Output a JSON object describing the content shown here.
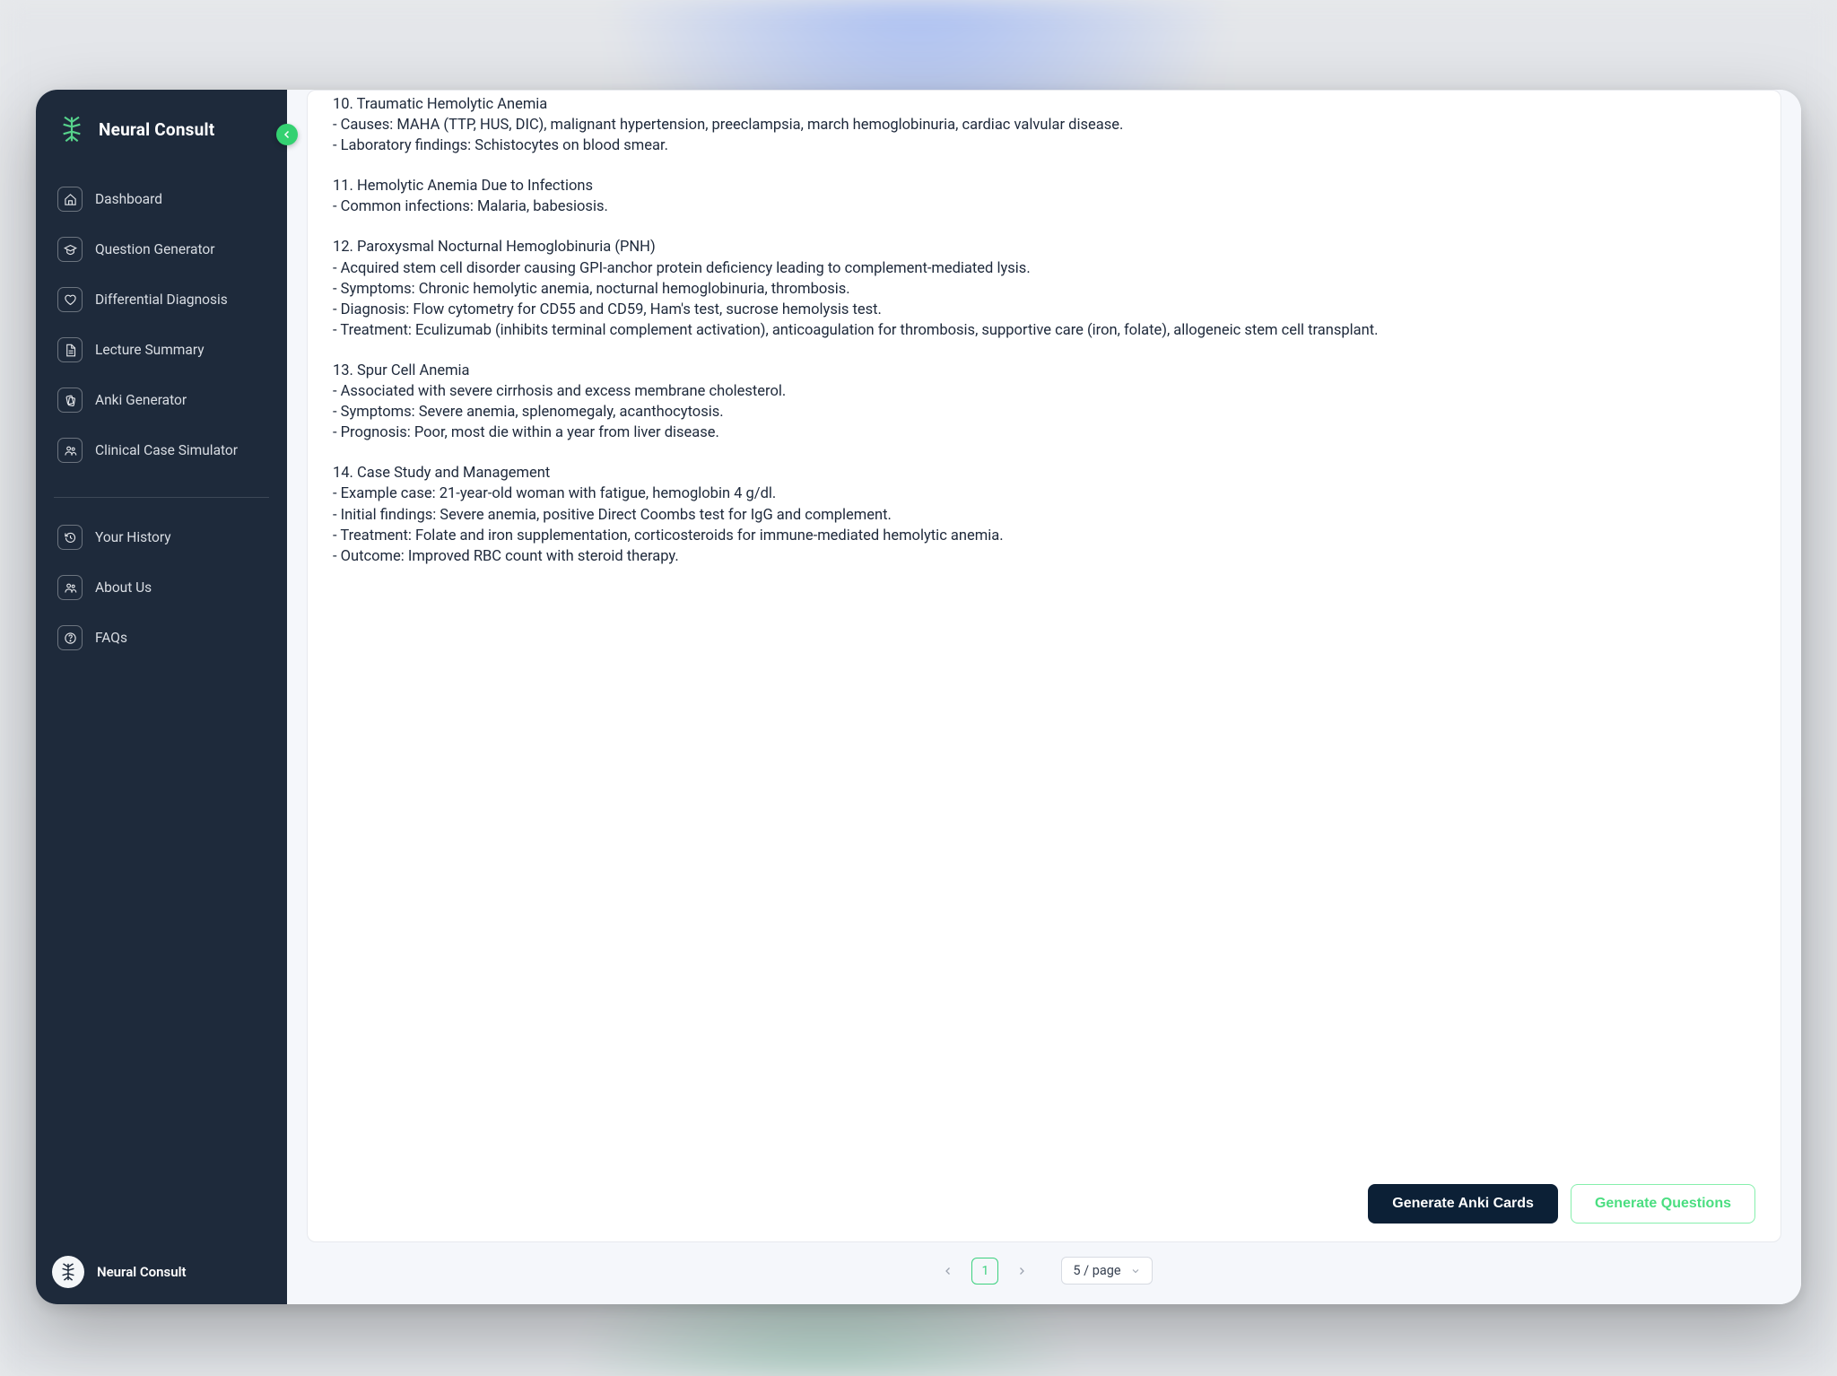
{
  "brand": {
    "title": "Neural Consult"
  },
  "sidebar": {
    "items_top": [
      {
        "label": "Dashboard",
        "name": "sidebar-item-dashboard",
        "icon": "home-icon"
      },
      {
        "label": "Question Generator",
        "name": "sidebar-item-question-generator",
        "icon": "cap-icon"
      },
      {
        "label": "Differential Diagnosis",
        "name": "sidebar-item-differential-diagnosis",
        "icon": "heart-icon"
      },
      {
        "label": "Lecture Summary",
        "name": "sidebar-item-lecture-summary",
        "icon": "file-icon"
      },
      {
        "label": "Anki Generator",
        "name": "sidebar-item-anki-generator",
        "icon": "cards-icon"
      },
      {
        "label": "Clinical Case Simulator",
        "name": "sidebar-item-clinical-case-simulator",
        "icon": "people-icon"
      }
    ],
    "items_bottom": [
      {
        "label": "Your History",
        "name": "sidebar-item-your-history",
        "icon": "history-icon"
      },
      {
        "label": "About Us",
        "name": "sidebar-item-about-us",
        "icon": "people-icon"
      },
      {
        "label": "FAQs",
        "name": "sidebar-item-faqs",
        "icon": "help-icon"
      }
    ],
    "footer_name": "Neural Consult"
  },
  "content": {
    "sections": [
      "10. Traumatic Hemolytic Anemia\n- Causes: MAHA (TTP, HUS, DIC), malignant hypertension, preeclampsia, march hemoglobinuria, cardiac valvular disease.\n- Laboratory findings: Schistocytes on blood smear.",
      "11. Hemolytic Anemia Due to Infections\n- Common infections: Malaria, babesiosis.",
      "12. Paroxysmal Nocturnal Hemoglobinuria (PNH)\n- Acquired stem cell disorder causing GPI-anchor protein deficiency leading to complement-mediated lysis.\n- Symptoms: Chronic hemolytic anemia, nocturnal hemoglobinuria, thrombosis.\n- Diagnosis: Flow cytometry for CD55 and CD59, Ham's test, sucrose hemolysis test.\n- Treatment: Eculizumab (inhibits terminal complement activation), anticoagulation for thrombosis, supportive care (iron, folate), allogeneic stem cell transplant.",
      "13. Spur Cell Anemia\n- Associated with severe cirrhosis and excess membrane cholesterol.\n- Symptoms: Severe anemia, splenomegaly, acanthocytosis.\n- Prognosis: Poor, most die within a year from liver disease.",
      "14. Case Study and Management\n- Example case: 21-year-old woman with fatigue, hemoglobin 4 g/dl.\n- Initial findings: Severe anemia, positive Direct Coombs test for IgG and complement.\n- Treatment: Folate and iron supplementation, corticosteroids for immune-mediated hemolytic anemia.\n- Outcome: Improved RBC count with steroid therapy."
    ]
  },
  "actions": {
    "anki": "Generate Anki Cards",
    "questions": "Generate Questions"
  },
  "pagination": {
    "current": "1",
    "page_size_label": "5 / page"
  }
}
